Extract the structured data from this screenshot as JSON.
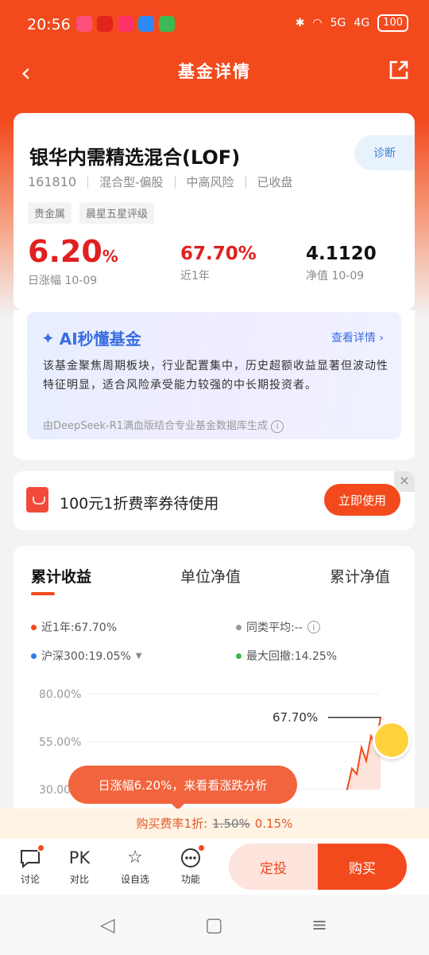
{
  "status_bar": {
    "time": "20:56",
    "battery": "100",
    "network_1": "5G",
    "network_2": "4G",
    "apps": [
      "vivo",
      "JD",
      "music",
      "browser",
      "chat"
    ]
  },
  "nav": {
    "title": "基金详情",
    "back_icon": "back-arrow-icon",
    "share_icon": "share-icon"
  },
  "fund": {
    "name": "银华内需精选混合(LOF)",
    "code": "161810",
    "type": "混合型-偏股",
    "risk": "中高风险",
    "collected": "已收盘",
    "diagnose_label": "诊断",
    "tags": [
      "贵金属",
      "晨星五星评级"
    ]
  },
  "metrics": {
    "daily_change": {
      "value": "6.20",
      "unit": "%",
      "label": "日涨幅 10-09"
    },
    "year_return": {
      "value": "67.70%",
      "label": "近1年"
    },
    "nav": {
      "value": "4.1120",
      "label": "净值 10-09"
    }
  },
  "ai": {
    "title": "AI秒懂基金",
    "more": "查看详情",
    "body": "该基金聚焦周期板块，行业配置集中，历史超额收益显著但波动性特征明显，适合风险承受能力较强的中长期投资者。",
    "footer": "由DeepSeek-R1满血版结合专业基金数据库生成"
  },
  "coupon": {
    "text": "100元1折费率券待使用",
    "button": "立即使用",
    "close": "×"
  },
  "performance": {
    "tabs": [
      "累计收益",
      "单位净值",
      "累计净值"
    ],
    "legend": {
      "fund": "近1年:67.70%",
      "peer": "同类平均:--",
      "index": "沪深300:19.05%",
      "drawdown": "最大回撤:14.25%"
    },
    "colors": {
      "fund": "#f24a1d",
      "peer": "#999999",
      "index": "#2b7de9",
      "drawdown": "#3cb64a"
    }
  },
  "chart_data": {
    "type": "line",
    "ytick_labels": [
      "80.00%",
      "55.00%",
      "30.00%"
    ],
    "end_label": "67.70%",
    "series": [
      {
        "name": "近1年",
        "values": [
          30,
          41,
          38,
          52,
          45,
          58,
          53,
          67.7
        ]
      }
    ]
  },
  "tooltip": "日涨幅6.20%，来看看涨跌分析",
  "fee_bar": {
    "prefix": "购买费率1折:",
    "original": "1.50%",
    "discount": "0.15%"
  },
  "bottom_bar": {
    "items": [
      {
        "label": "讨论",
        "icon": "chat-bubble-icon"
      },
      {
        "label": "对比",
        "icon": "pk-icon",
        "glyph": "PK"
      },
      {
        "label": "设自选",
        "icon": "star-add-icon"
      },
      {
        "label": "功能",
        "icon": "more-dots-icon"
      }
    ],
    "dingtou": "定投",
    "buy": "购买"
  }
}
